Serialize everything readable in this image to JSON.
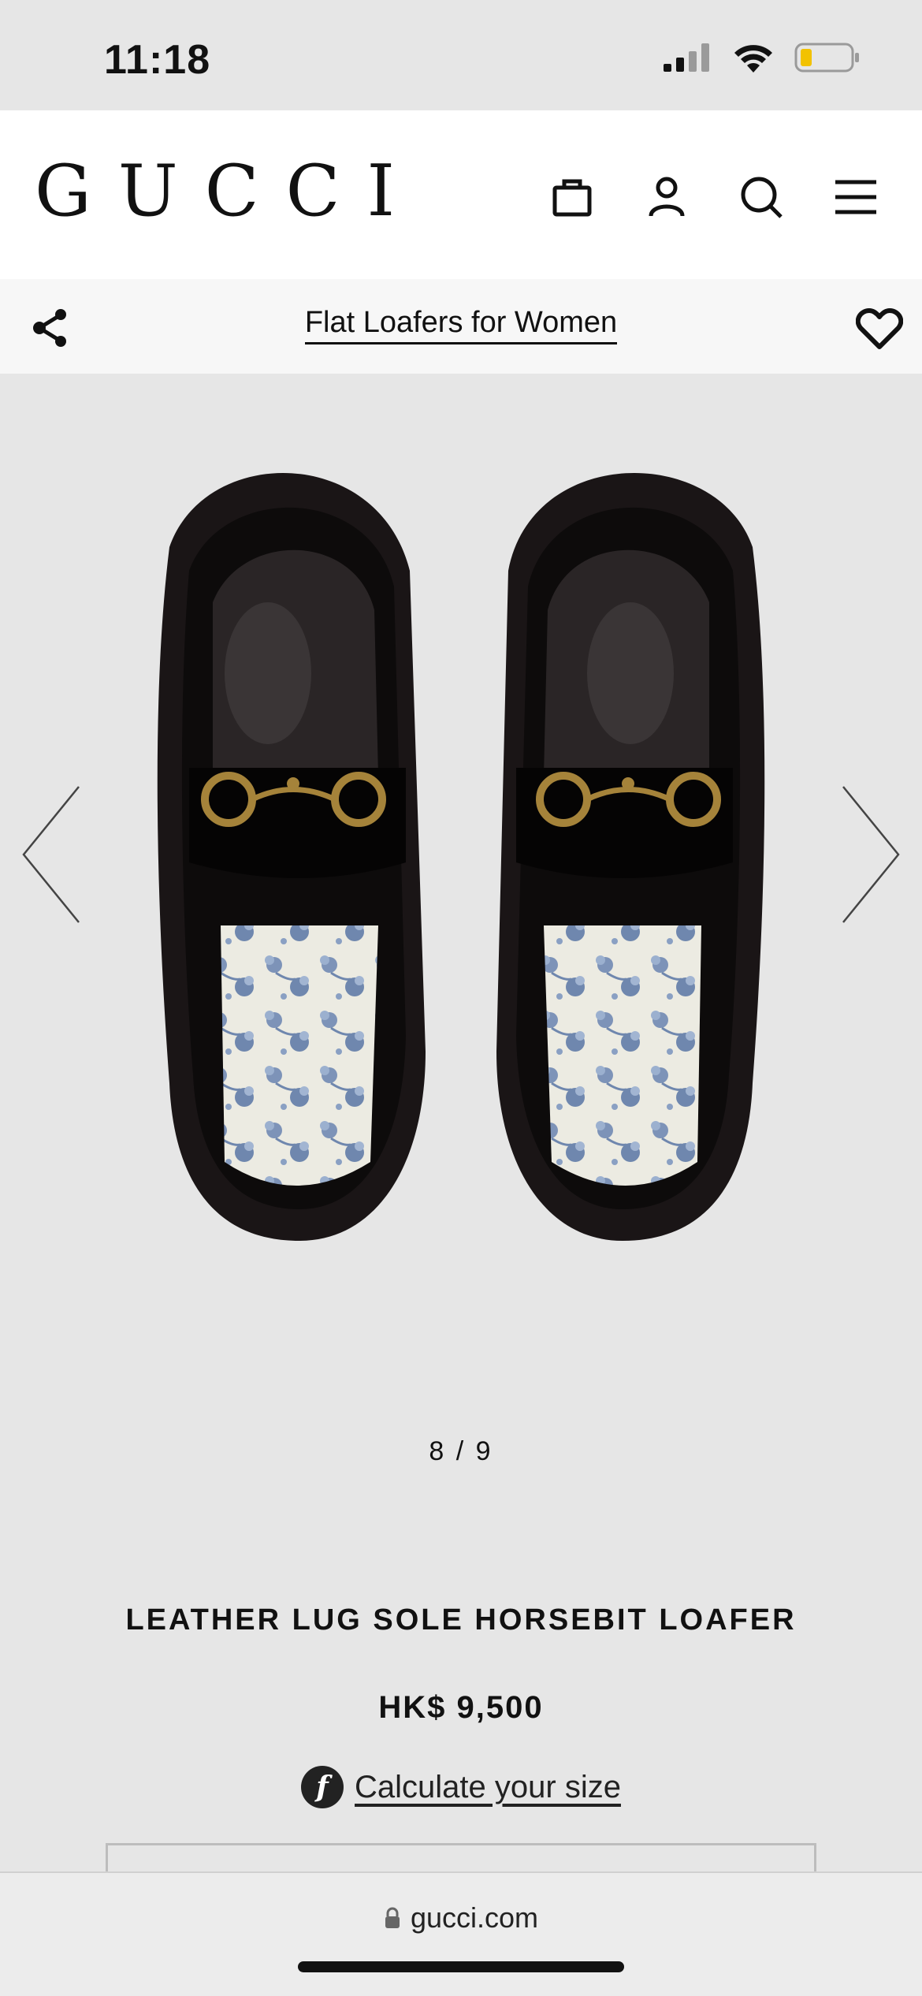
{
  "status_bar": {
    "time": "11:18",
    "battery_color": "#f2c200"
  },
  "header": {
    "logo": "GUCCI",
    "icons": [
      "shopping-bag-icon",
      "user-icon",
      "search-icon",
      "menu-icon"
    ]
  },
  "subheader": {
    "title": "Flat Loafers for Women"
  },
  "gallery": {
    "counter": "8 / 9"
  },
  "product": {
    "name": "LEATHER LUG SOLE HORSEBIT LOAFER",
    "price": "HK$ 9,500",
    "fit_icon_letter": "f",
    "size_link": "Calculate your size"
  },
  "browser": {
    "url": "gucci.com"
  }
}
